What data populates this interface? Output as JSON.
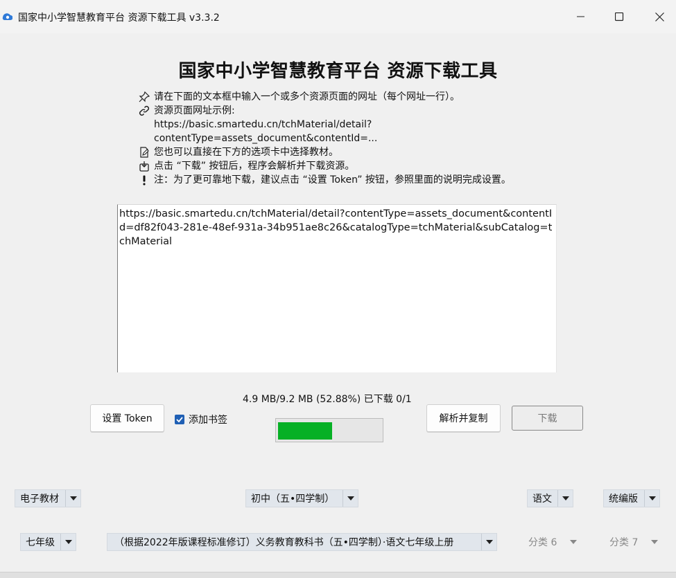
{
  "window": {
    "title": "国家中小学智慧教育平台 资源下载工具 v3.3.2"
  },
  "main_title": "国家中小学智慧教育平台 资源下载工具",
  "instructions": [
    {
      "icon": "pin-icon",
      "text": "请在下面的文本框中输入一个或多个资源页面的网址（每个网址一行）。"
    },
    {
      "icon": "link-icon",
      "text": "资源页面网址示例:"
    },
    {
      "icon": "",
      "text": "https://basic.smartedu.cn/tchMaterial/detail?"
    },
    {
      "icon": "",
      "text": "contentType=assets_document&contentId=..."
    },
    {
      "icon": "edit-document-icon",
      "text": "您也可以直接在下方的选项卡中选择教材。"
    },
    {
      "icon": "download-box-icon",
      "text": "点击 “下载” 按钮后，程序会解析并下载资源。"
    },
    {
      "icon": "exclamation-icon",
      "text": "注：为了更可靠地下载，建议点击 “设置 Token” 按钮，参照里面的说明完成设置。"
    }
  ],
  "url_input": {
    "value": "https://basic.smartedu.cn/tchMaterial/detail?contentType=assets_document&contentId=df82f043-281e-48ef-931a-34b951ae8c26&catalogType=tchMaterial&subCatalog=tchMaterial"
  },
  "progress": {
    "text": "4.9 MB/9.2 MB (52.88%) 已下载 0/1",
    "fraction": 0.5288
  },
  "buttons": {
    "set_token": "设置 Token",
    "bookmark_label": "添加书签",
    "bookmark_checked": true,
    "parse_copy": "解析并复制",
    "download": "下载"
  },
  "filters": {
    "row1": [
      {
        "label": "电子教材"
      },
      {
        "label": "初中（五•四学制）"
      },
      {
        "label": "语文"
      },
      {
        "label": "统编版"
      }
    ],
    "row2": [
      {
        "label": "七年级"
      },
      {
        "label": "（根据2022年版课程标准修订）义务教育教科书（五•四学制）·语文七年级上册"
      },
      {
        "label": "分类 6"
      },
      {
        "label": "分类 7"
      }
    ]
  },
  "colors": {
    "progress_fill": "#06b025",
    "checkbox": "#1f5fb4",
    "combo_bg": "#e1e6ec"
  }
}
